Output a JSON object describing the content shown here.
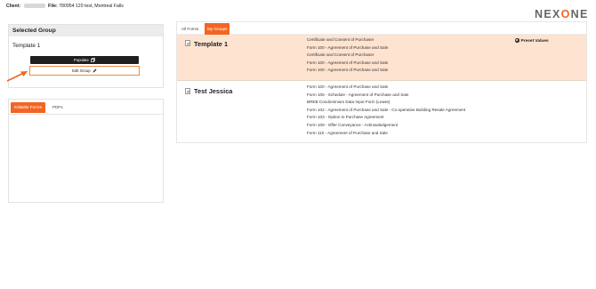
{
  "header": {
    "client_label": "Client:",
    "file_label": "File:",
    "file_value": "780954 120 test, Montreal Falls",
    "logo_part1": "NEX",
    "logo_part2": "O",
    "logo_part3": "NE"
  },
  "selected_group": {
    "heading": "Selected Group",
    "name": "Template 1",
    "populate_label": "Populate",
    "edit_label": "Edit Group"
  },
  "left_tabs": {
    "editable": "Editable Forms",
    "pdfs": "PDFs"
  },
  "right_tabs": {
    "all_forms": "All Forms",
    "my_groups": "My Groups"
  },
  "groups": [
    {
      "name": "Template 1",
      "preset_label": "Preset Values",
      "forms": [
        "Certificate and Consent of Purchaser",
        "Form 100 - Agreement of Purchase and Sale",
        "Certificate and Consent of Purchaser",
        "Form 100 - Agreement of Purchase and Sale",
        "Form 100 - Agreement of Purchase and Sale"
      ]
    },
    {
      "name": "Test Jessica",
      "forms": [
        "Form 100 - Agreement of Purchase and Sale",
        "Form 105 - Schedule - Agreement of Purchase and Sale",
        "BREB Condominium Data Input Form (Lease)",
        "Form 102 - Agreement of Purchase and Sale - Co-operative Building Resale Agreement",
        "Form 103 - Option to Purchase Agreement",
        "Form 109 - Offer Conveyance - Acknowledgement",
        "Form 110 - Agreement of Purchase and Sale"
      ]
    }
  ],
  "colors": {
    "accent": "#f26522",
    "highlight_row": "#fde3d0",
    "button_dark": "#1f1f1f"
  }
}
